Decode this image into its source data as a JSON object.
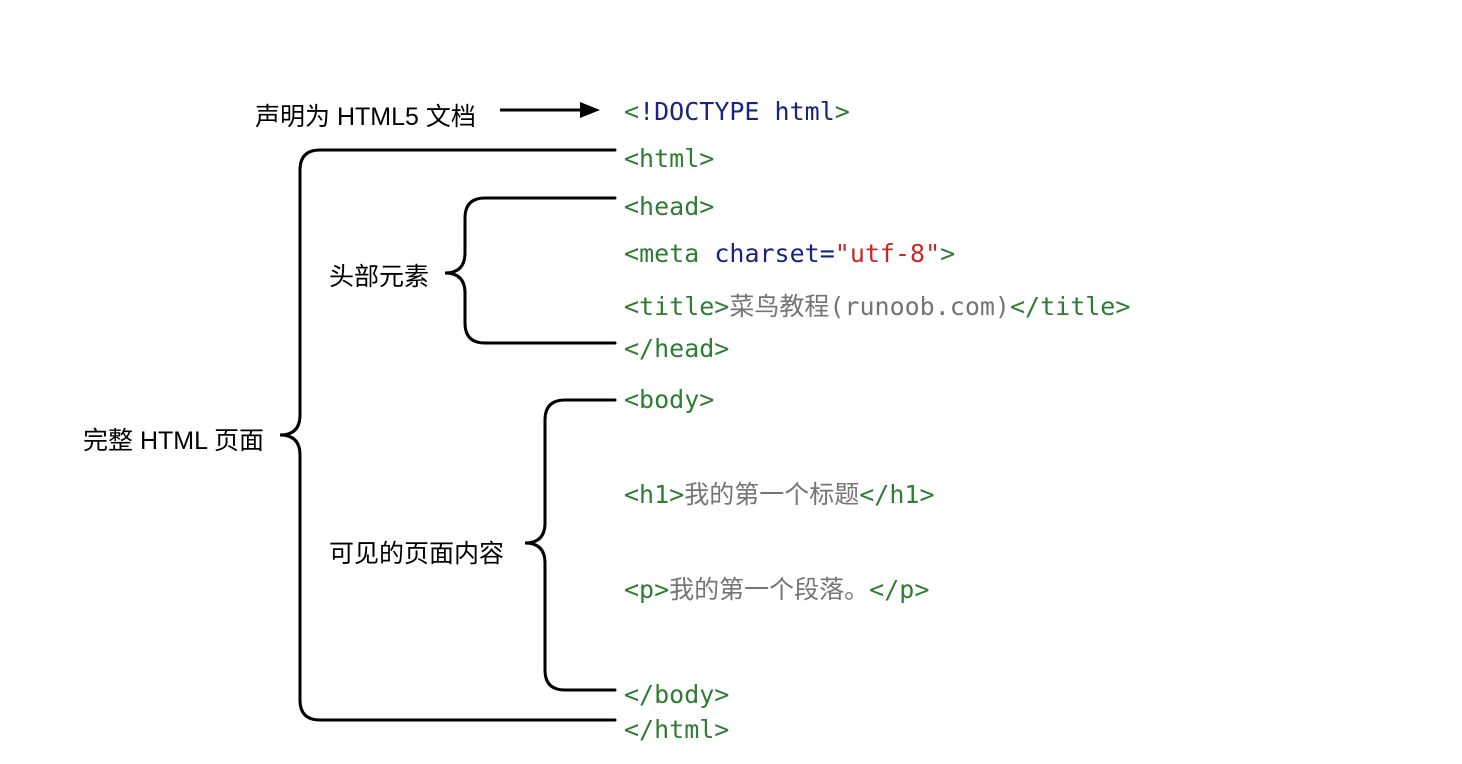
{
  "labels": {
    "doctype_decl": "声明为 HTML5 文档",
    "full_page": "完整 HTML 页面",
    "head_elements": "头部元素",
    "body_content": "可见的页面内容"
  },
  "code": {
    "doctype_open": "<",
    "doctype_bang": "!",
    "doctype_text": "DOCTYPE html",
    "doctype_close": ">",
    "html_open": "<html>",
    "head_open": "<head>",
    "meta_open": "<",
    "meta_name": "meta",
    "meta_space": " ",
    "meta_attr": "charset",
    "meta_eq": "=",
    "meta_val": "\"utf-8\"",
    "meta_close": ">",
    "title_open": "<title>",
    "title_text": "菜鸟教程(runoob.com)",
    "title_close": "</title>",
    "head_close": "</head>",
    "body_open": "<body>",
    "h1_open": "<h1>",
    "h1_text": "我的第一个标题",
    "h1_close": "</h1>",
    "p_open": "<p>",
    "p_text": "我的第一个段落。",
    "p_close": "</p>",
    "body_close": "</body>",
    "html_close": "</html>"
  }
}
